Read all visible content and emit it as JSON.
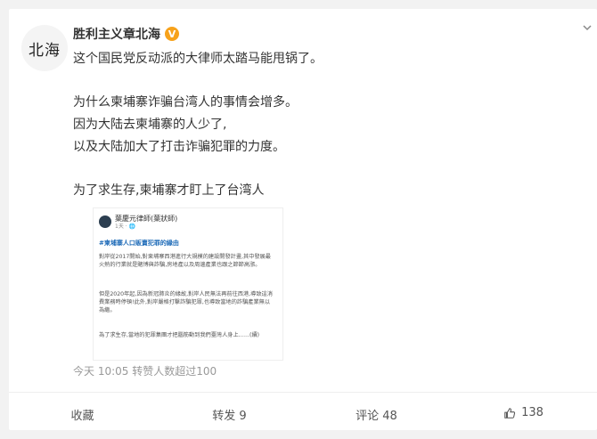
{
  "post": {
    "avatar_text": "北海",
    "username": "胜利主义章北海",
    "verified_badge": "V",
    "lines": [
      "这个国民党反动派的大律师太踏马能甩锅了。",
      "为什么柬埔寨诈骗台湾人的事情会增多。",
      "因为大陆去柬埔寨的人少了,",
      "以及大陆加大了打击诈骗犯罪的力度。",
      "为了求生存,柬埔寨才盯上了台湾人"
    ],
    "timestamp": "今天 10:05",
    "repost_note": "转赞人数超过100"
  },
  "embed": {
    "author": "葉慶元律師(葉狀師)",
    "sub": "1天 · 🌐",
    "hashtag": "#柬埔寨人口販賣犯罪的緣由",
    "para1": "對岸從2017開始,對柬埔寨西港進行大規模的建設開發計畫,其中發展最火熱的行業就是賭博與詐騙,房地產以及周邊產業也跟之節節高漲。",
    "para2": "但是2020年起,因為新冠肺炎的緣故,對岸人民無法再前往西港,導致這消費業務時停頓!此外,對岸嚴格打擊詐騙犯罪,也導致當地的詐騙產業無以為繼。",
    "para3": "為了求生存,當地的犯罪集團才把腦筋動到我們臺灣人身上……(續)"
  },
  "actions": {
    "favorite": "收藏",
    "repost": "转发 9",
    "comment": "评论 48",
    "like": "138"
  },
  "icons": {
    "more": "chevron-down-icon",
    "like": "thumbs-up-icon",
    "verified": "verified-badge-icon"
  },
  "colors": {
    "background": "#f2f2f2",
    "card": "#ffffff",
    "badge": "#f7a21b",
    "link": "#1e6bb8"
  }
}
